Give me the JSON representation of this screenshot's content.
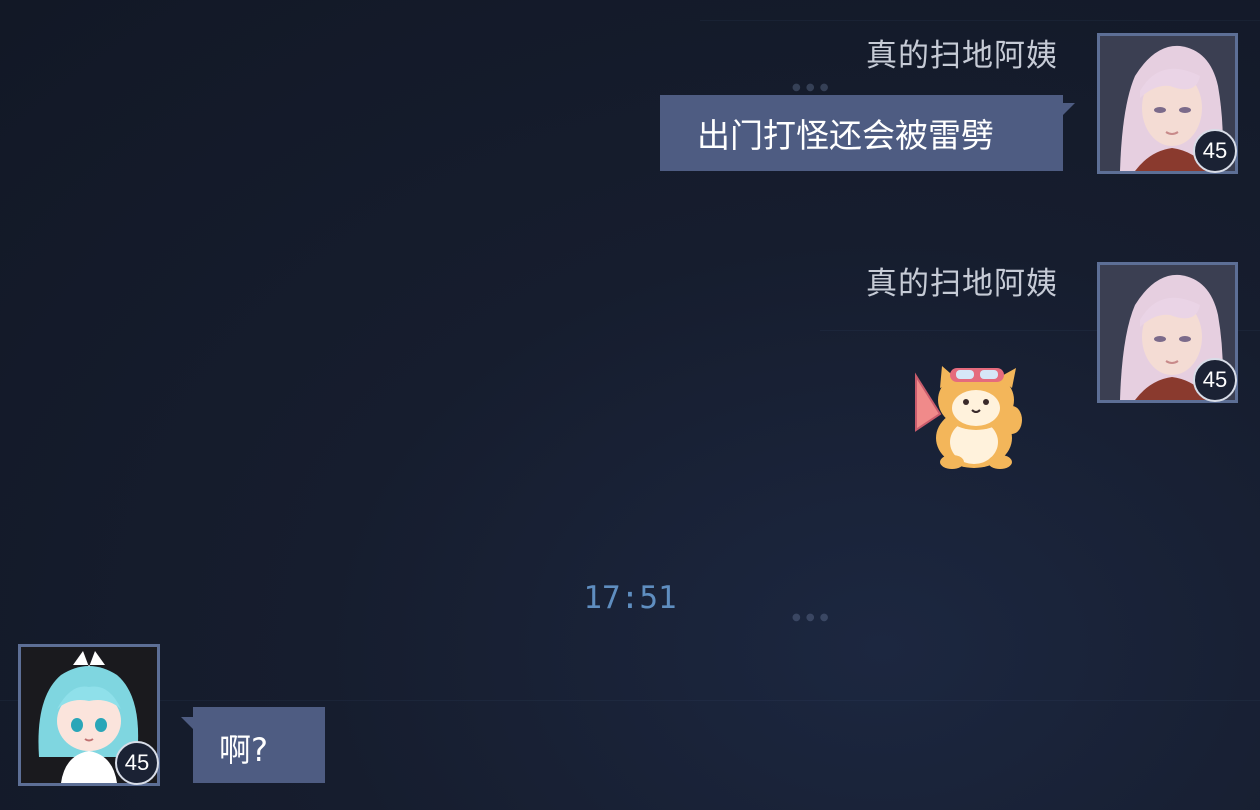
{
  "messages": [
    {
      "sender": "真的扫地阿姨",
      "level": "45",
      "text": "出门打怪还会被雷劈",
      "avatar_icon": "pink-haired-character-portrait"
    },
    {
      "sender": "真的扫地阿姨",
      "level": "45",
      "sticker_icon": "shiba-dog-sticker-with-pink-flag",
      "avatar_icon": "pink-haired-character-portrait"
    },
    {
      "level": "45",
      "text": "啊?",
      "avatar_icon": "cyan-haired-chibi-maid-portrait"
    }
  ],
  "timestamp": "17:51",
  "colors": {
    "bubble": "#4e5c82",
    "timestamp": "#5f8ec0",
    "avatar_border": "#5d6f96",
    "background": "#161d2e"
  }
}
